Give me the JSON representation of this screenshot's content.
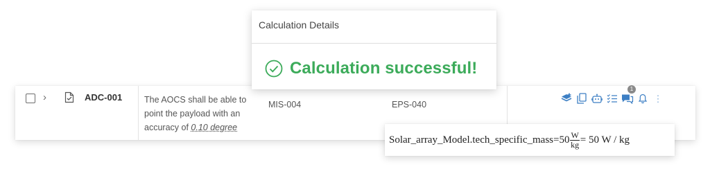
{
  "popup": {
    "title": "Calculation Details",
    "status": "Calculation successful!",
    "status_color": "#3cab5a"
  },
  "row": {
    "id": "ADC-001",
    "description_prefix": "The AOCS shall be able to point the payload with an accuracy of ",
    "description_value": "0.10 degree",
    "parent_link": "MIS-004",
    "child_link": "EPS-040",
    "notification_count": "1"
  },
  "formula": {
    "lhs": "Solar_array_Model.tech_specific_mass=50",
    "unit_numerator": "W",
    "unit_denominator": "kg",
    "rhs": "= 50 W / kg"
  },
  "icons": {
    "check": "checkbox-icon",
    "expand": "chevron-right-icon",
    "document": "document-check-icon",
    "success": "circle-check-icon",
    "actions": [
      "layers-add-icon",
      "copy-icon",
      "robot-icon",
      "checklist-icon",
      "comments-icon",
      "bell-icon",
      "more-vertical-icon"
    ]
  },
  "colors": {
    "accent_blue": "#3d7fc4",
    "success_green": "#3cab5a"
  }
}
